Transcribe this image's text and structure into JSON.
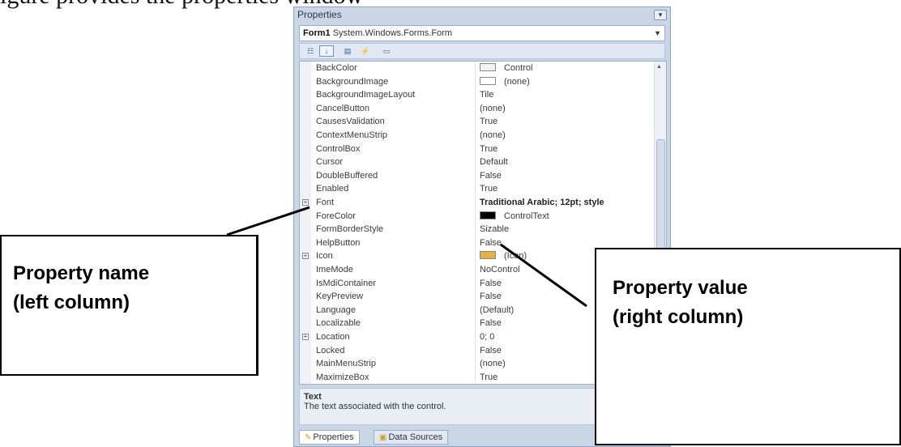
{
  "top_text": "igure provides the properties window",
  "properties": {
    "title": "Properties",
    "object": {
      "name": "Form1",
      "type": "System.Windows.Forms.Form"
    },
    "rows": [
      {
        "name": "BackColor",
        "value": "Control",
        "swatch": "#f2f2f2",
        "expandable": false
      },
      {
        "name": "BackgroundImage",
        "value": "(none)",
        "swatch": "#ffffff",
        "expandable": false
      },
      {
        "name": "BackgroundImageLayout",
        "value": "Tile",
        "expandable": false
      },
      {
        "name": "CancelButton",
        "value": "(none)",
        "expandable": false
      },
      {
        "name": "CausesValidation",
        "value": "True",
        "expandable": false
      },
      {
        "name": "ContextMenuStrip",
        "value": "(none)",
        "expandable": false
      },
      {
        "name": "ControlBox",
        "value": "True",
        "expandable": false
      },
      {
        "name": "Cursor",
        "value": "Default",
        "expandable": false
      },
      {
        "name": "DoubleBuffered",
        "value": "False",
        "expandable": false
      },
      {
        "name": "Enabled",
        "value": "True",
        "expandable": false
      },
      {
        "name": "Font",
        "value": "Traditional Arabic; 12pt; style",
        "bold": true,
        "expandable": true
      },
      {
        "name": "ForeColor",
        "value": "ControlText",
        "swatch": "#000000",
        "expandable": false
      },
      {
        "name": "FormBorderStyle",
        "value": "Sizable",
        "expandable": false
      },
      {
        "name": "HelpButton",
        "value": "False",
        "expandable": false
      },
      {
        "name": "Icon",
        "value": "(Icon)",
        "swatch": "#e8b23a",
        "expandable": true
      },
      {
        "name": "ImeMode",
        "value": "NoControl",
        "expandable": false
      },
      {
        "name": "IsMdiContainer",
        "value": "False",
        "expandable": false
      },
      {
        "name": "KeyPreview",
        "value": "False",
        "expandable": false
      },
      {
        "name": "Language",
        "value": "(Default)",
        "expandable": false
      },
      {
        "name": "Localizable",
        "value": "False",
        "expandable": false
      },
      {
        "name": "Location",
        "value": "0; 0",
        "expandable": true
      },
      {
        "name": "Locked",
        "value": "False",
        "expandable": false
      },
      {
        "name": "MainMenuStrip",
        "value": "(none)",
        "expandable": false
      },
      {
        "name": "MaximizeBox",
        "value": "True",
        "expandable": false
      }
    ],
    "description": {
      "title": "Text",
      "text": "The text associated with the control."
    },
    "tabs": [
      {
        "label": "Properties",
        "active": true
      },
      {
        "label": "Data Sources",
        "active": false
      }
    ]
  },
  "callouts": {
    "name_label": "Property name\n(left column)",
    "value_label": "Property value\n(right column)"
  }
}
